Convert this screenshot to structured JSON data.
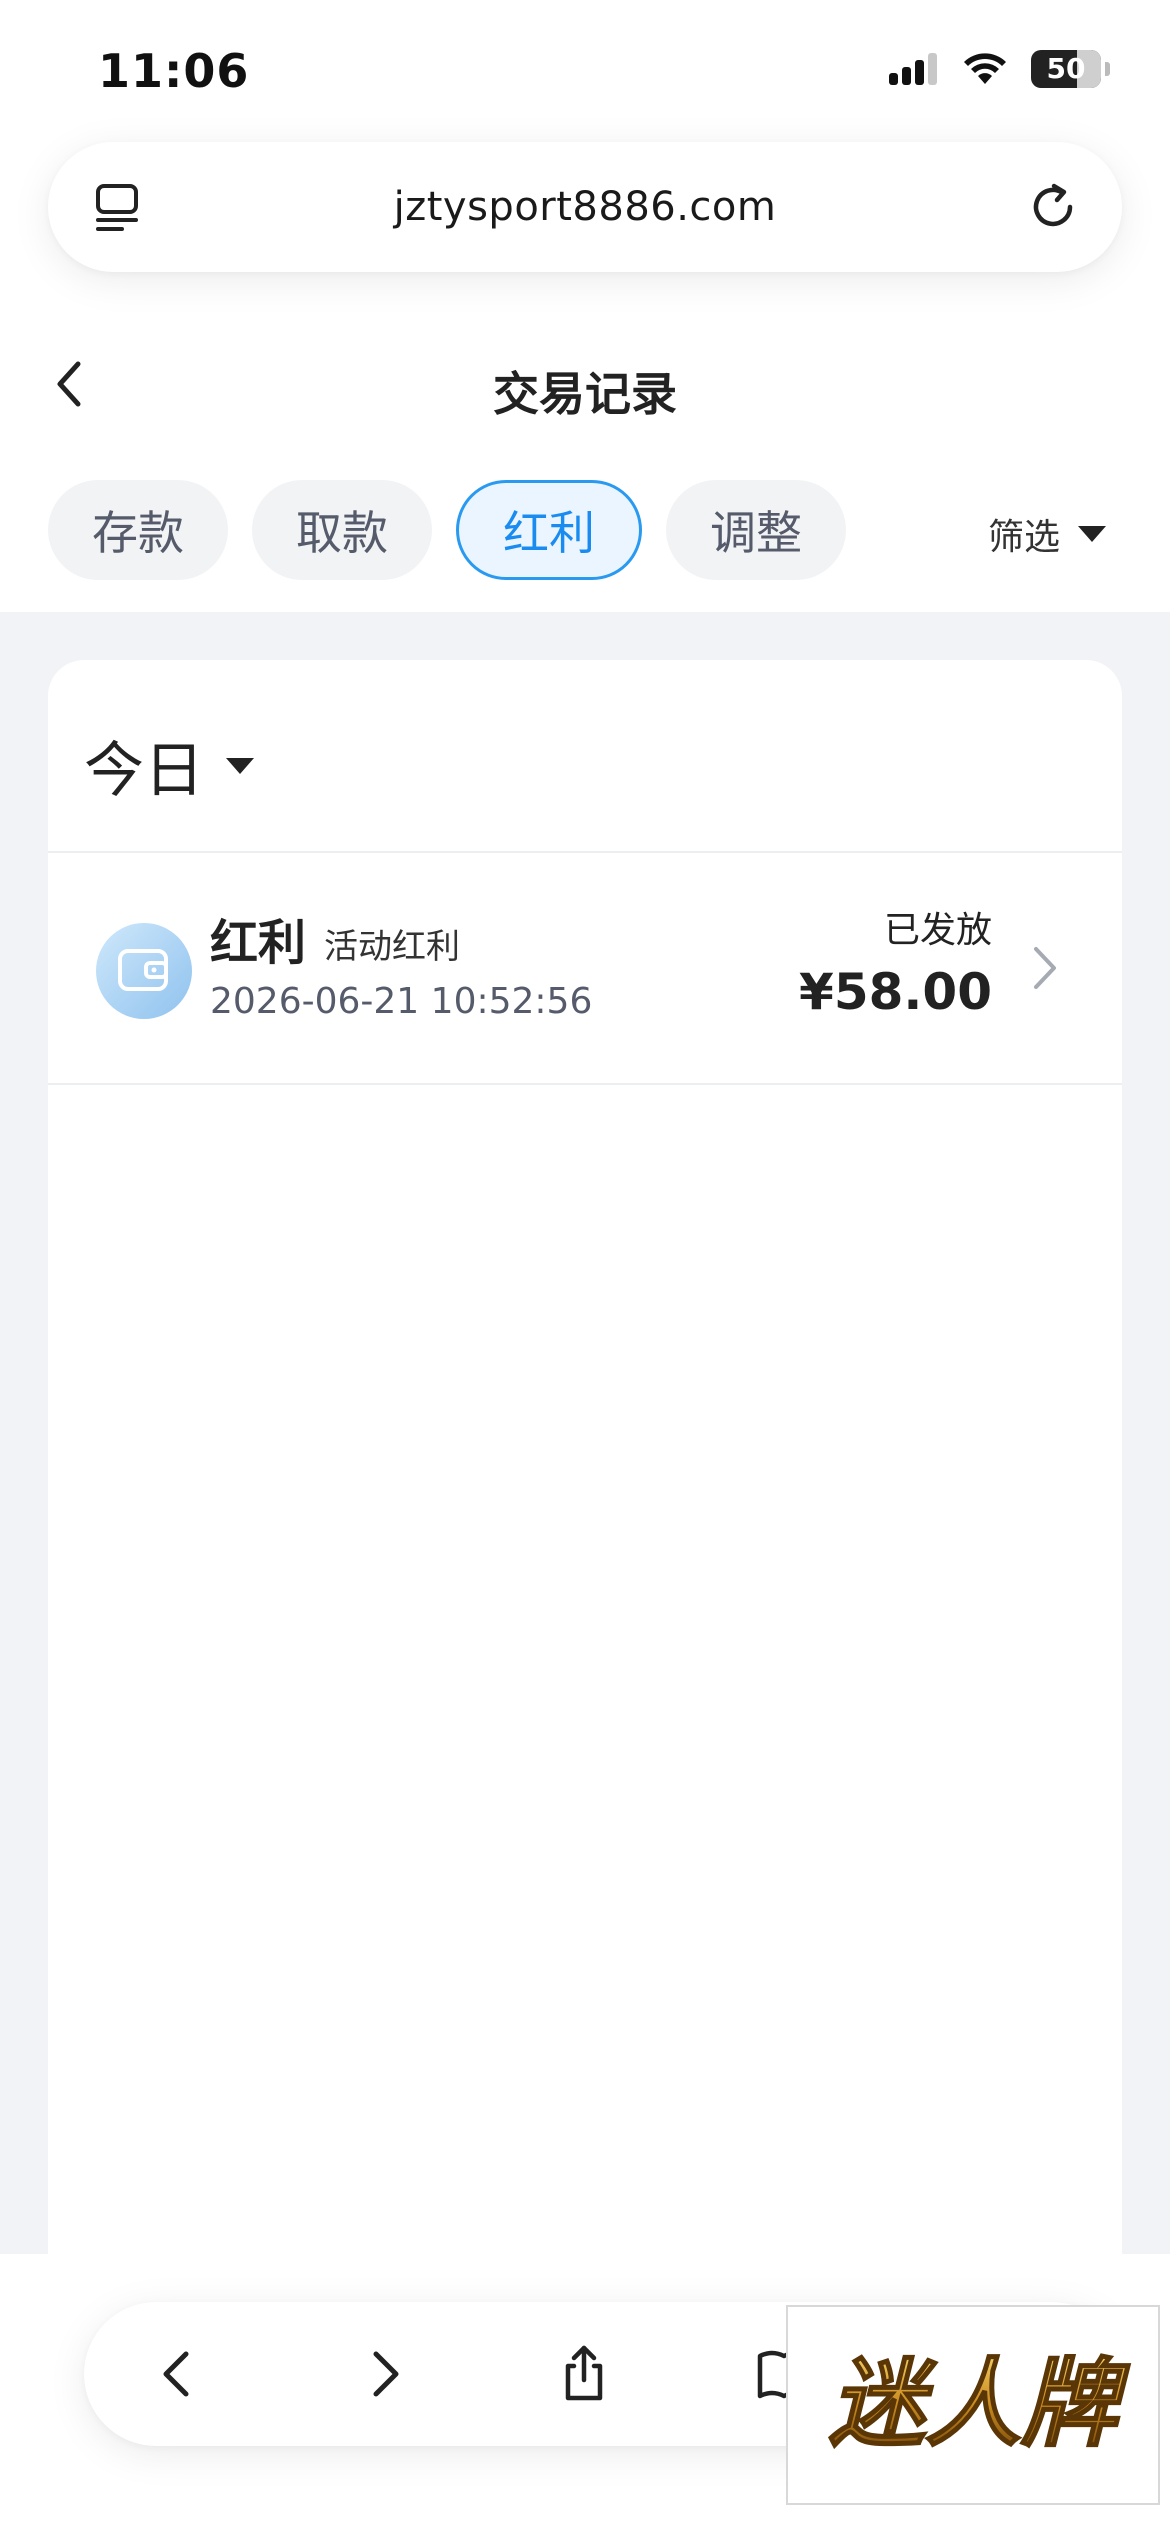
{
  "status_bar": {
    "time": "11:06",
    "battery": "50"
  },
  "browser": {
    "url": "jztysport8886.com"
  },
  "header": {
    "title": "交易记录"
  },
  "tabs": [
    {
      "label": "存款",
      "active": false
    },
    {
      "label": "取款",
      "active": false
    },
    {
      "label": "红利",
      "active": true
    },
    {
      "label": "调整",
      "active": false
    }
  ],
  "filter": {
    "label": "筛选"
  },
  "date_group": {
    "label": "今日"
  },
  "records": [
    {
      "type": "红利",
      "subtype": "活动红利",
      "time": "2026-06-21 10:52:56",
      "status": "已发放",
      "amount": "¥58.00",
      "icon": "wallet-icon"
    }
  ],
  "watermark": {
    "text": "迷人牌"
  },
  "colors": {
    "accent": "#1a8cf0",
    "page_bg": "#f2f3f7",
    "tab_bg": "#f2f3f5"
  }
}
